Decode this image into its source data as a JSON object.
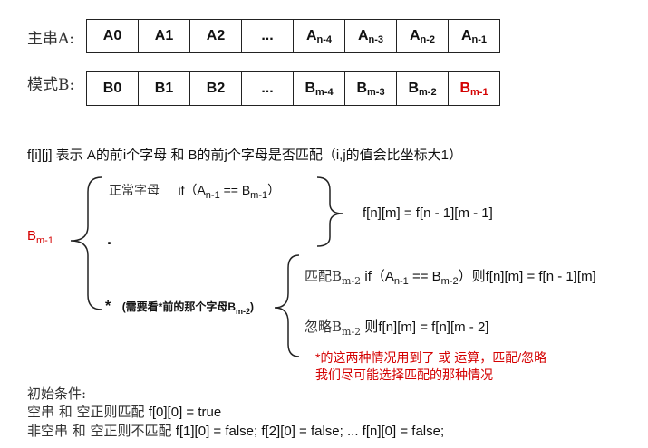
{
  "row_a": {
    "label": "主串A:",
    "cells": [
      {
        "main": "A0",
        "sub": ""
      },
      {
        "main": "A1",
        "sub": ""
      },
      {
        "main": "A2",
        "sub": ""
      },
      {
        "main": "...",
        "sub": ""
      },
      {
        "main": "A",
        "sub": "n-4"
      },
      {
        "main": "A",
        "sub": "n-3"
      },
      {
        "main": "A",
        "sub": "n-2"
      },
      {
        "main": "A",
        "sub": "n-1"
      }
    ]
  },
  "row_b": {
    "label": "模式B:",
    "cells": [
      {
        "main": "B0",
        "sub": ""
      },
      {
        "main": "B1",
        "sub": ""
      },
      {
        "main": "B2",
        "sub": ""
      },
      {
        "main": "...",
        "sub": ""
      },
      {
        "main": "B",
        "sub": "m-4"
      },
      {
        "main": "B",
        "sub": "m-3"
      },
      {
        "main": "B",
        "sub": "m-2"
      },
      {
        "main": "B",
        "sub": "m-1"
      }
    ]
  },
  "highlight_color": "#d40000",
  "definition": "f[i][j] 表示 A的前i个字母 和 B的前j个字母是否匹配（i,j的值会比坐标大1）",
  "root_node": {
    "main": "B",
    "sub": "m-1"
  },
  "case_normal": {
    "label": "正常字母",
    "cond_prefix": "if（A",
    "cond_sub_a": "n-1",
    "cond_mid": " == B",
    "cond_sub_b": "m-1",
    "cond_suffix": "）"
  },
  "case_dot": ".",
  "formula_normal": "f[n][m] = f[n - 1][m - 1]",
  "case_star": {
    "symbol": "*",
    "note_prefix": "(需要看*前的那个字母B",
    "note_sub": "m-2",
    "note_suffix": ")"
  },
  "match_branch": {
    "label_prefix": "匹配B",
    "label_sub": "m-2",
    "cond_prefix": " if（A",
    "cond_sub_a": "n-1",
    "cond_mid": " == B",
    "cond_sub_b": "m-2",
    "cond_suffix": "）则",
    "formula": "f[n][m] = f[n - 1][m]"
  },
  "ignore_branch": {
    "label_prefix": "忽略B",
    "label_sub": "m-2",
    "rule": " 则f[n][m] = f[n][m - 2]"
  },
  "red_note": [
    "*的这两种情况用到了 或 运算，匹配/忽略",
    "我们尽可能选择匹配的那种情况"
  ],
  "init": {
    "title": "初始条件:",
    "line1_prefix": "空串 和 空正则匹配",
    "line1_value": " f[0][0] = true",
    "line2_prefix": "非空串 和 空正则不匹配",
    "line2_value": " f[1][0] = false; f[2][0] = false;  ...  f[n][0] = false;"
  }
}
